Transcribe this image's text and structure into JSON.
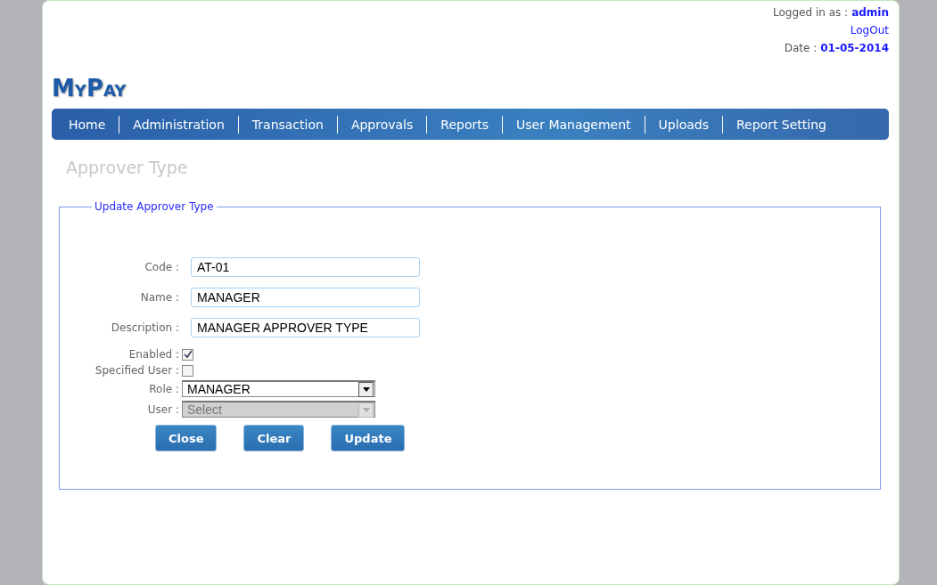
{
  "header": {
    "logged_in_label": "Logged in as :",
    "user": "admin",
    "logout": "LogOut",
    "date_label": "Date :",
    "date": "01-05-2014"
  },
  "logo": "MyPay",
  "nav": [
    {
      "label": "Home"
    },
    {
      "label": "Administration"
    },
    {
      "label": "Transaction"
    },
    {
      "label": "Approvals"
    },
    {
      "label": "Reports"
    },
    {
      "label": "User Management"
    },
    {
      "label": "Uploads"
    },
    {
      "label": "Report Setting"
    }
  ],
  "page_title": "Approver Type",
  "form": {
    "legend": "Update Approver Type",
    "fields": [
      {
        "kind": "text",
        "label": "Code :",
        "value": "AT-01"
      },
      {
        "kind": "text",
        "label": "Name :",
        "value": "MANAGER"
      },
      {
        "kind": "text",
        "label": "Description :",
        "value": "MANAGER APPROVER TYPE"
      },
      {
        "kind": "checkbox",
        "label": "Enabled :",
        "checked": true
      },
      {
        "kind": "checkbox",
        "label": "Specified User :",
        "checked": false
      },
      {
        "kind": "select",
        "label": "Role :",
        "value": "MANAGER",
        "disabled": false
      },
      {
        "kind": "select",
        "label": "User :",
        "value": "Select",
        "disabled": true
      }
    ],
    "buttons": [
      "Close",
      "Clear",
      "Update"
    ]
  }
}
